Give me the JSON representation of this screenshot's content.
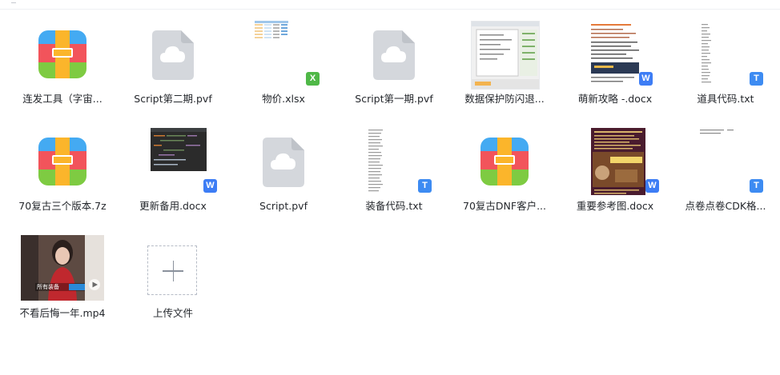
{
  "files": [
    {
      "name": "连发工具（字宙...",
      "icon": "archive-icon"
    },
    {
      "name": "Script第二期.pvf",
      "icon": "cloud-file-icon"
    },
    {
      "name": "物价.xlsx",
      "icon": "xlsx-thumbnail",
      "badge": "X"
    },
    {
      "name": "Script第一期.pvf",
      "icon": "cloud-file-icon"
    },
    {
      "name": "数据保护防闪退...",
      "icon": "screenshot-thumbnail"
    },
    {
      "name": "萌新攻略 -.docx",
      "icon": "docx-thumbnail",
      "badge": "W"
    },
    {
      "name": "道具代码.txt",
      "icon": "txt-thumbnail",
      "badge": "T"
    },
    {
      "name": "70复古三个版本.7z",
      "icon": "archive-icon"
    },
    {
      "name": "更新备用.docx",
      "icon": "docx-thumbnail",
      "badge": "W"
    },
    {
      "name": "Script.pvf",
      "icon": "cloud-file-icon"
    },
    {
      "name": "装备代码.txt",
      "icon": "txt-thumbnail",
      "badge": "T"
    },
    {
      "name": "70复古DNF客户...",
      "icon": "archive-icon"
    },
    {
      "name": "重要参考图.docx",
      "icon": "docx-thumbnail",
      "badge": "W"
    },
    {
      "name": "点卷点卷CDK格...",
      "icon": "txt-thumbnail",
      "badge": "T"
    },
    {
      "name": "不看后悔一年.mp4",
      "icon": "video-thumbnail",
      "overlay": "所有装备"
    },
    {
      "name": "上传文件",
      "icon": "plus-icon"
    }
  ],
  "colors": {
    "archive_blue": "#44aaf2",
    "archive_red": "#f2545b",
    "archive_green": "#7ecb42",
    "archive_strap": "#fbb52b",
    "badge_word": "#3d7df5",
    "badge_excel": "#4fb847"
  }
}
